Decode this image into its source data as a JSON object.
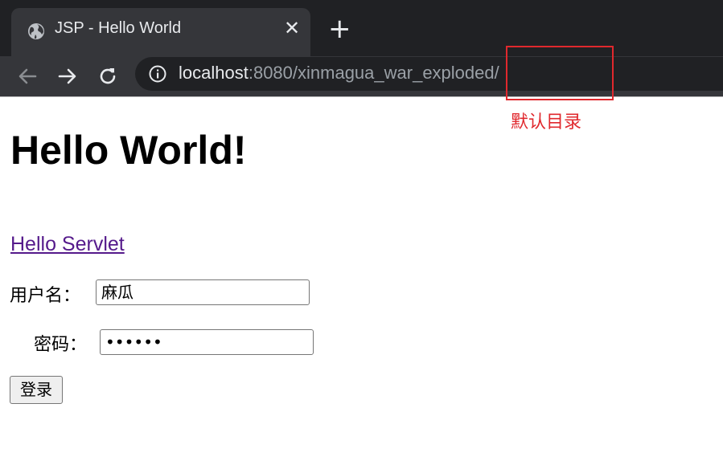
{
  "browser": {
    "tab": {
      "title": "JSP - Hello World",
      "favicon": "globe-icon",
      "close": "✕"
    },
    "new_tab": "+",
    "address": {
      "host": "localhost",
      "rest": ":8080/xinmagua_war_exploded/"
    }
  },
  "annotation": {
    "label": "默认目录",
    "color": "#e0282d"
  },
  "page": {
    "heading": "Hello World!",
    "link": "Hello Servlet",
    "form": {
      "username_label": "用户名：",
      "username_value": "麻瓜",
      "password_label": "密码：",
      "password_value": "••••••",
      "submit_label": "登录"
    }
  },
  "colors": {
    "chrome_dark": "#202124",
    "chrome_tab": "#35363a",
    "visited_link": "#551a8b"
  }
}
